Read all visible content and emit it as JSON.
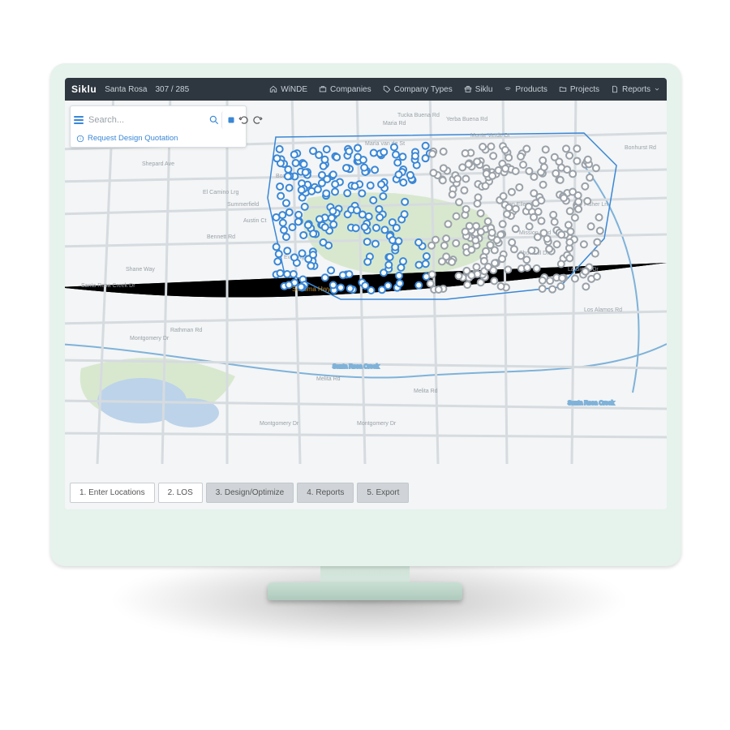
{
  "brand": "Siklu",
  "breadcrumb": {
    "project": "Santa Rosa",
    "counts": "307 / 285"
  },
  "nav": [
    {
      "icon": "home",
      "label": "WiNDE"
    },
    {
      "icon": "briefcase",
      "label": "Companies"
    },
    {
      "icon": "tag",
      "label": "Company Types"
    },
    {
      "icon": "gift",
      "label": "Siklu"
    },
    {
      "icon": "wifi",
      "label": "Products"
    },
    {
      "icon": "folder",
      "label": "Projects"
    },
    {
      "icon": "file",
      "label": "Reports",
      "caret": true
    }
  ],
  "search": {
    "placeholder": "Search..."
  },
  "quote_link": "Request Design Quotation",
  "steps": [
    {
      "label": "1. Enter Locations",
      "active": true
    },
    {
      "label": "2. LOS",
      "active": true
    },
    {
      "label": "3. Design/Optimize",
      "active": false
    },
    {
      "label": "4. Reports",
      "active": false
    },
    {
      "label": "5. Export",
      "active": false
    }
  ],
  "map_labels": {
    "hwy": "Sonoma Hwy",
    "creek1": "Santa Rosa Creek",
    "creek2": "Santa Rosa Creek",
    "roads": [
      "Montgomery Dr",
      "Montgomery Dr",
      "Montgomery Dr",
      "Melita Rd",
      "Melita Rd",
      "Boas Dr",
      "Mission Blvd",
      "Los Alamos Rd",
      "La Sierra Dr",
      "Fisher Ln",
      "Bonhurst Rd",
      "Monte Verde Dr",
      "Maria Rd",
      "Maria van de St",
      "Yerba Buena Rd",
      "Tucka Buena Rd",
      "Shepard Ave",
      "El Camino Lrg",
      "Shorehill Dr",
      "Bennett Rd",
      "Austin Ct",
      "Glen Ellen Ln",
      "Shane Way",
      "Summerfield",
      "Evening Way",
      "Santa Rosa Creek Dr",
      "Rathman Rd"
    ]
  },
  "colors": {
    "accent": "#3a87d6",
    "topbar": "#2e3740",
    "step_off": "#d0d4d8"
  }
}
